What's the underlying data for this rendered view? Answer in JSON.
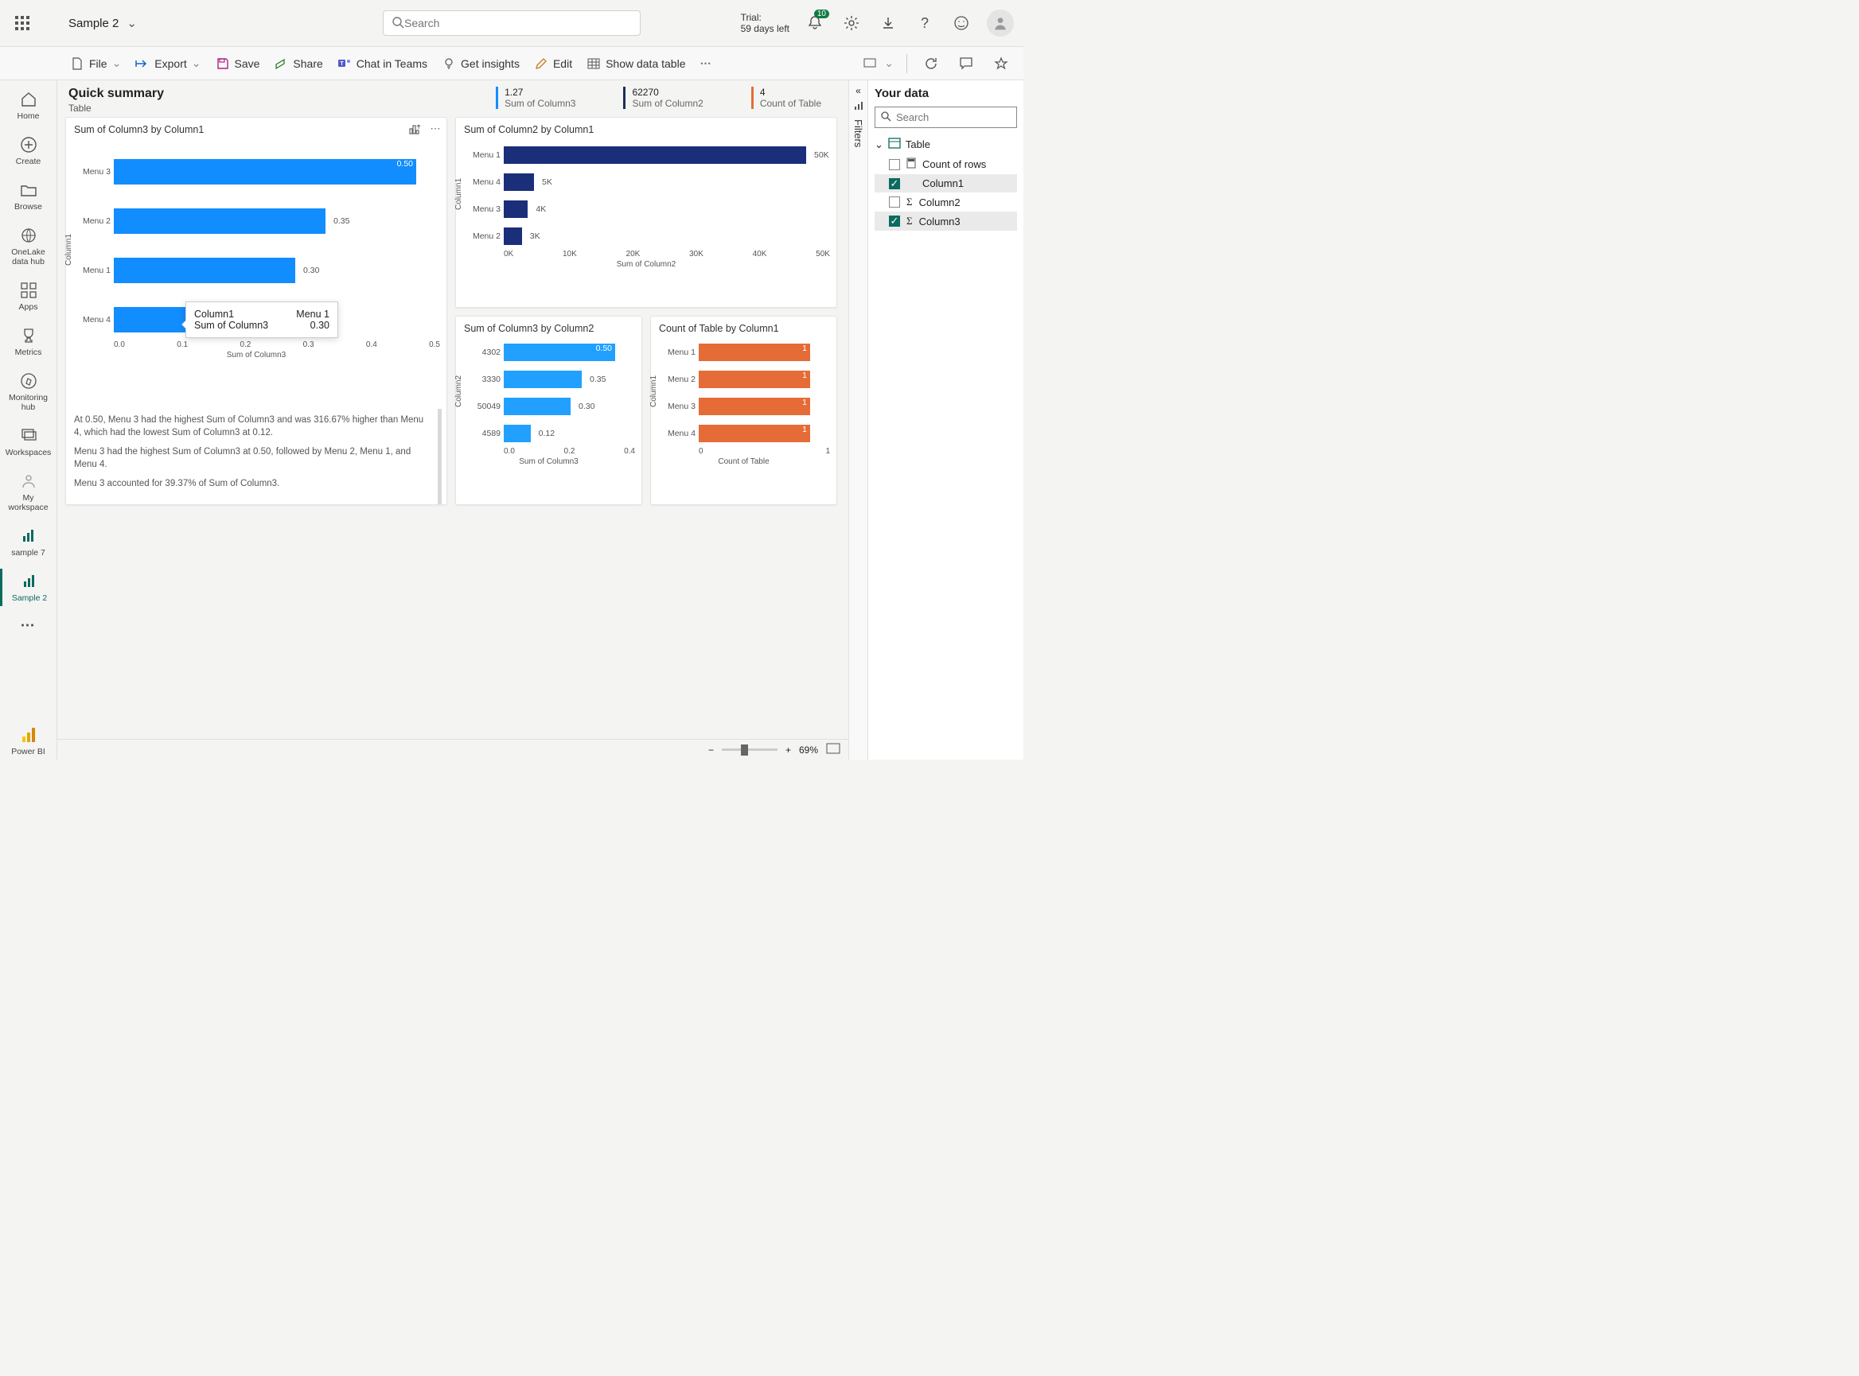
{
  "header": {
    "title": "Sample 2",
    "search_placeholder": "Search",
    "trial_line1": "Trial:",
    "trial_line2": "59 days left",
    "notif_count": "10"
  },
  "commands": {
    "file": "File",
    "export": "Export",
    "save": "Save",
    "share": "Share",
    "chat": "Chat in Teams",
    "insights": "Get insights",
    "edit": "Edit",
    "show_table": "Show data table"
  },
  "nav": {
    "home": "Home",
    "create": "Create",
    "browse": "Browse",
    "onelake": "OneLake data hub",
    "apps": "Apps",
    "metrics": "Metrics",
    "monitoring": "Monitoring hub",
    "workspaces": "Workspaces",
    "my_ws": "My workspace",
    "sample7": "sample 7",
    "sample2": "Sample 2",
    "powerbi": "Power BI"
  },
  "report": {
    "title": "Quick summary",
    "subtitle": "Table",
    "kpi1_val": "1.27",
    "kpi1_lab": "Sum of Column3",
    "kpi2_val": "62270",
    "kpi2_lab": "Sum of Column2",
    "kpi3_val": "4",
    "kpi3_lab": "Count of Table",
    "tooltip_col_label": "Column1",
    "tooltip_col_val": "Menu 1",
    "tooltip_sum_label": "Sum of Column3",
    "tooltip_sum_val": "0.30",
    "insight1": "At 0.50, Menu 3 had the highest Sum of Column3 and was 316.67% higher than Menu 4, which had the lowest Sum of Column3 at 0.12.",
    "insight2": "Menu 3 had the highest Sum of Column3 at 0.50, followed by Menu 2, Menu 1, and Menu 4.",
    "insight3": "Menu 3 accounted for 39.37% of Sum of Column3."
  },
  "chart_data": [
    {
      "id": "chart1",
      "type": "bar",
      "orientation": "horizontal",
      "title": "Sum of Column3 by Column1",
      "xlabel": "Sum of Column3",
      "ylabel": "Column1",
      "xlim": [
        0,
        0.5
      ],
      "xticks": [
        "0.0",
        "0.1",
        "0.2",
        "0.3",
        "0.4",
        "0.5"
      ],
      "categories": [
        "Menu 3",
        "Menu 2",
        "Menu 1",
        "Menu 4"
      ],
      "values": [
        0.5,
        0.35,
        0.3,
        0.12
      ],
      "value_labels": [
        "0.50",
        "0.35",
        "0.30",
        ""
      ],
      "color": "#118dff"
    },
    {
      "id": "chart2",
      "type": "bar",
      "orientation": "horizontal",
      "title": "Sum of Column2 by Column1",
      "xlabel": "Sum of Column2",
      "ylabel": "Column1",
      "xlim": [
        0,
        50000
      ],
      "xticks": [
        "0K",
        "10K",
        "20K",
        "30K",
        "40K",
        "50K"
      ],
      "categories": [
        "Menu 1",
        "Menu 4",
        "Menu 3",
        "Menu 2"
      ],
      "values": [
        50000,
        5000,
        4000,
        3000
      ],
      "value_labels": [
        "50K",
        "5K",
        "4K",
        "3K"
      ],
      "color": "#1a2e7a"
    },
    {
      "id": "chart3",
      "type": "bar",
      "orientation": "horizontal",
      "title": "Sum of Column3 by Column2",
      "xlabel": "Sum of Column3",
      "ylabel": "Column2",
      "xlim": [
        0,
        0.5
      ],
      "xticks": [
        "0.0",
        "0.2",
        "0.4"
      ],
      "categories": [
        "4302",
        "3330",
        "50049",
        "4589"
      ],
      "values": [
        0.5,
        0.35,
        0.3,
        0.12
      ],
      "value_labels": [
        "0.50",
        "0.35",
        "0.30",
        "0.12"
      ],
      "color": "#21a0ff"
    },
    {
      "id": "chart4",
      "type": "bar",
      "orientation": "horizontal",
      "title": "Count of Table by Column1",
      "xlabel": "Count of Table",
      "ylabel": "Column1",
      "xlim": [
        0,
        1
      ],
      "xticks": [
        "0",
        "1"
      ],
      "categories": [
        "Menu 1",
        "Menu 2",
        "Menu 3",
        "Menu 4"
      ],
      "values": [
        1,
        1,
        1,
        1
      ],
      "value_labels": [
        "1",
        "1",
        "1",
        "1"
      ],
      "color": "#e66c37"
    }
  ],
  "filters_label": "Filters",
  "data_pane": {
    "title": "Your data",
    "search_placeholder": "Search",
    "table": "Table",
    "fields": [
      {
        "name": "Count of rows",
        "checked": false,
        "icon": "calc",
        "sel": false
      },
      {
        "name": "Column1",
        "checked": true,
        "icon": "",
        "sel": true
      },
      {
        "name": "Column2",
        "checked": false,
        "icon": "sigma",
        "sel": false
      },
      {
        "name": "Column3",
        "checked": true,
        "icon": "sigma",
        "sel": true
      }
    ]
  },
  "status_bar": {
    "zoom": "69%"
  }
}
